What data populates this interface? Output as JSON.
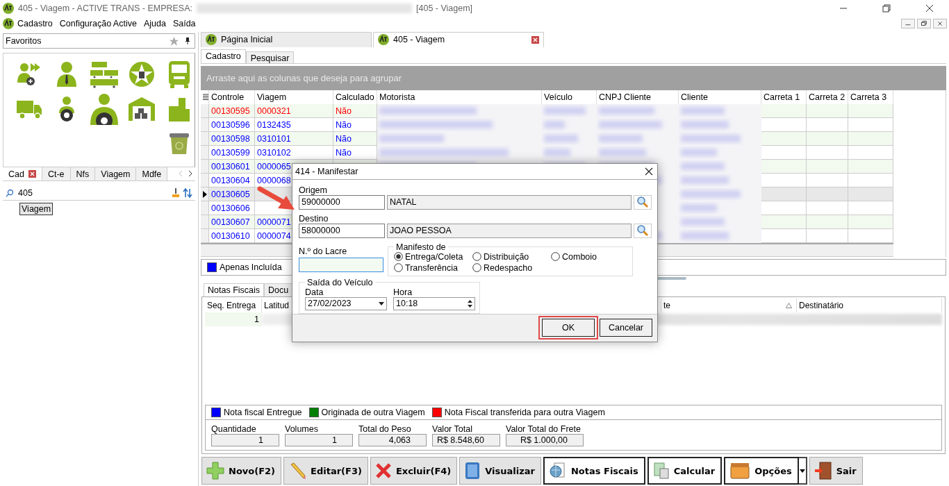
{
  "window": {
    "title": "405 - Viagem - ACTIVE TRANS - EMPRESA:",
    "document": "[405 - Viagem]"
  },
  "menu": [
    {
      "label": "Cadastro"
    },
    {
      "label": "Configuração Active"
    },
    {
      "label": "Ajuda"
    },
    {
      "label": "Saída"
    }
  ],
  "favorites": {
    "title": "Favoritos"
  },
  "nav_tabs": [
    {
      "label": "Cad",
      "selected": true,
      "closable": true
    },
    {
      "label": "Ct-e",
      "selected": false,
      "closable": false
    },
    {
      "label": "Nfs",
      "selected": false,
      "closable": false
    },
    {
      "label": "Viagem",
      "selected": false,
      "closable": false
    },
    {
      "label": "Mdfe",
      "selected": false,
      "closable": false
    }
  ],
  "nav_search": {
    "value": "405"
  },
  "tree": [
    {
      "label": "Viagem",
      "selected": true
    }
  ],
  "doc_tabs": [
    {
      "label": "Página Inicial",
      "selected": false,
      "closable": false
    },
    {
      "label": "405 - Viagem",
      "selected": true,
      "closable": true
    }
  ],
  "sub_tabs": [
    {
      "label": "Cadastro",
      "selected": true
    },
    {
      "label": "Pesquisar",
      "selected": false
    }
  ],
  "group_panel": {
    "hint": "Arraste aqui as colunas que deseja para agrupar"
  },
  "grid": {
    "columns": [
      "Controle",
      "Viagem",
      "Calculado",
      "Motorista",
      "Veículo",
      "CNPJ Cliente",
      "Cliente",
      "Carreta 1",
      "Carreta 2",
      "Carreta 3"
    ],
    "rows": [
      {
        "cells": [
          "00130595",
          "0000321",
          "Não"
        ],
        "color": "#ff0000",
        "current": false
      },
      {
        "cells": [
          "00130596",
          "0132435",
          "Não"
        ],
        "color": "#0000ff",
        "current": false
      },
      {
        "cells": [
          "00130598",
          "0310101",
          "Não"
        ],
        "color": "#0000ff",
        "current": false
      },
      {
        "cells": [
          "00130599",
          "0310102",
          "Não"
        ],
        "color": "#0000ff",
        "current": false
      },
      {
        "cells": [
          "00130601",
          "0000065"
        ],
        "color": "#0000ff",
        "current": false
      },
      {
        "cells": [
          "00130604",
          "0000068"
        ],
        "color": "#0000ff",
        "current": false
      },
      {
        "cells": [
          "00130605"
        ],
        "color": "#0000ff",
        "current": true
      },
      {
        "cells": [
          "00130606"
        ],
        "color": "#0000ff",
        "current": false
      },
      {
        "cells": [
          "00130607",
          "0000071"
        ],
        "color": "#0000ff",
        "current": false
      },
      {
        "cells": [
          "00130610",
          "0000074"
        ],
        "color": "#0000ff",
        "current": false
      }
    ]
  },
  "filter_legend": {
    "label": "Apenas Incluída",
    "color": "#0000ff"
  },
  "detail_tabs": [
    {
      "label": "Notas Fiscais",
      "selected": true
    },
    {
      "label": "Docu",
      "selected": false
    }
  ],
  "detail_grid": {
    "columns": [
      {
        "label": "Seq. Entrega"
      },
      {
        "label": "Latitud"
      },
      {
        "label": "te",
        "sorted": true
      },
      {
        "label": "Destinatário",
        "sorted": false
      }
    ],
    "rows": [
      {
        "cells": [
          "1"
        ]
      }
    ]
  },
  "legend": [
    {
      "label": "Nota fiscal Entregue",
      "color": "#0000ff"
    },
    {
      "label": "Originada de outra Viagem",
      "color": "#008000"
    },
    {
      "label": "Nota Fiscal transferida para outra Viagem",
      "color": "#ff0000"
    }
  ],
  "totals": [
    {
      "label": "Quantidade",
      "value": "1"
    },
    {
      "label": "Volumes",
      "value": "1"
    },
    {
      "label": "Total do Peso",
      "value": "4,063"
    },
    {
      "label": "Valor Total",
      "value": "R$ 8.548,60"
    },
    {
      "label": "Valor Total do Frete",
      "value": "R$ 1.000,00"
    }
  ],
  "toolbar": [
    {
      "label": "Novo(F2)",
      "outlined": false,
      "dropdown": false
    },
    {
      "label": "Editar(F3)",
      "outlined": false,
      "dropdown": false
    },
    {
      "label": "Excluir(F4)",
      "outlined": false,
      "dropdown": false
    },
    {
      "label": "Visualizar",
      "outlined": false,
      "dropdown": false
    },
    {
      "label": "Notas Fiscais",
      "outlined": true,
      "dropdown": false
    },
    {
      "label": "Calcular",
      "outlined": true,
      "dropdown": false
    },
    {
      "label": "Opções",
      "outlined": true,
      "dropdown": true
    },
    {
      "label": "Sair",
      "outlined": false,
      "dropdown": false
    }
  ],
  "dialog": {
    "title": "414 - Manifestar",
    "origem": {
      "label": "Origem",
      "code": "59000000",
      "name": "NATAL"
    },
    "destino": {
      "label": "Destino",
      "code": "58000000",
      "name": "JOAO PESSOA"
    },
    "lacre": {
      "label": "N.º do Lacre"
    },
    "manifesto": {
      "label": "Manifesto de",
      "options": [
        {
          "label": "Entrega/Coleta",
          "selected": true
        },
        {
          "label": "Distribuição",
          "selected": false
        },
        {
          "label": "Comboio",
          "selected": false
        },
        {
          "label": "Transferência",
          "selected": false
        },
        {
          "label": "Redespacho",
          "selected": false
        }
      ]
    },
    "saida": {
      "label": "Saída do Veículo",
      "date_label": "Data",
      "date": "27/02/2023",
      "time_label": "Hora",
      "time": "10:18"
    },
    "buttons": [
      {
        "label": "OK",
        "highlighted": true
      },
      {
        "label": "Cancelar",
        "highlighted": false
      }
    ]
  }
}
